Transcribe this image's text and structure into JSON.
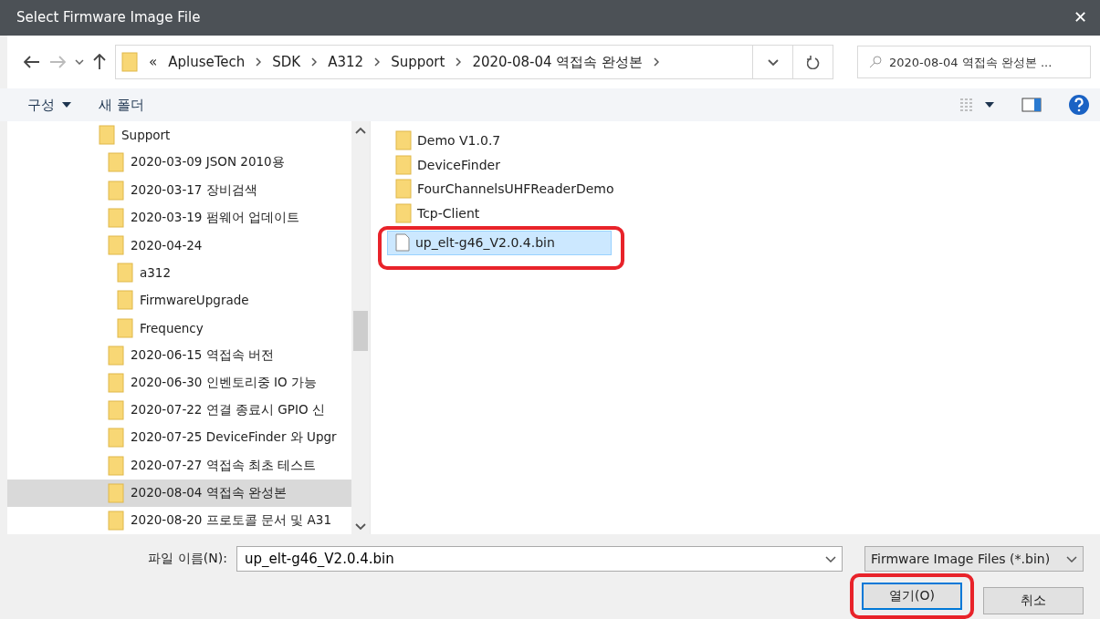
{
  "window": {
    "title": "Select Firmware Image File",
    "close": "✕"
  },
  "address_bar": {
    "overflow": "«",
    "path": [
      "ApluseTech",
      "SDK",
      "A312",
      "Support",
      "2020-08-04 역접속 완성본"
    ]
  },
  "search": {
    "placeholder": "2020-08-04 역접속 완성본 ..."
  },
  "toolbar": {
    "organize": "구성",
    "new_folder": "새 폴더"
  },
  "tree": [
    {
      "label": "Support",
      "selected": false,
      "children": [
        {
          "label": "2020-03-09 JSON 2010용",
          "selected": false
        },
        {
          "label": "2020-03-17 장비검색",
          "selected": false
        },
        {
          "label": "2020-03-19 펌웨어 업데이트",
          "selected": false
        },
        {
          "label": "2020-04-24",
          "selected": false,
          "children": [
            {
              "label": "a312",
              "selected": false
            },
            {
              "label": "FirmwareUpgrade",
              "selected": false
            },
            {
              "label": "Frequency",
              "selected": false
            }
          ]
        },
        {
          "label": "2020-06-15 역접속 버전",
          "selected": false
        },
        {
          "label": "2020-06-30 인벤토리중 IO 가능",
          "selected": false
        },
        {
          "label": "2020-07-22 연결 종료시 GPIO 신",
          "selected": false
        },
        {
          "label": "2020-07-25 DeviceFinder 와 Upgr",
          "selected": false
        },
        {
          "label": "2020-07-27 역접속 최초 테스트",
          "selected": false
        },
        {
          "label": "2020-08-04 역접속 완성본",
          "selected": true
        },
        {
          "label": "2020-08-20 프로토콜 문서 및 A31",
          "selected": false
        }
      ]
    }
  ],
  "files": [
    {
      "name": "Demo V1.0.7",
      "kind": "folder",
      "selected": false
    },
    {
      "name": "DeviceFinder",
      "kind": "folder",
      "selected": false
    },
    {
      "name": "FourChannelsUHFReaderDemo",
      "kind": "folder",
      "selected": false
    },
    {
      "name": "Tcp-Client",
      "kind": "folder",
      "selected": false
    },
    {
      "name": "up_elt-g46_V2.0.4.bin",
      "kind": "file",
      "selected": true
    }
  ],
  "filename": {
    "label": "파일 이름(N):",
    "value": "up_elt-g46_V2.0.4.bin"
  },
  "filter": {
    "value": "Firmware Image Files (*.bin)"
  },
  "buttons": [
    {
      "label": "열기(O)",
      "kind": "primary"
    },
    {
      "label": "취소",
      "kind": "normal"
    }
  ]
}
